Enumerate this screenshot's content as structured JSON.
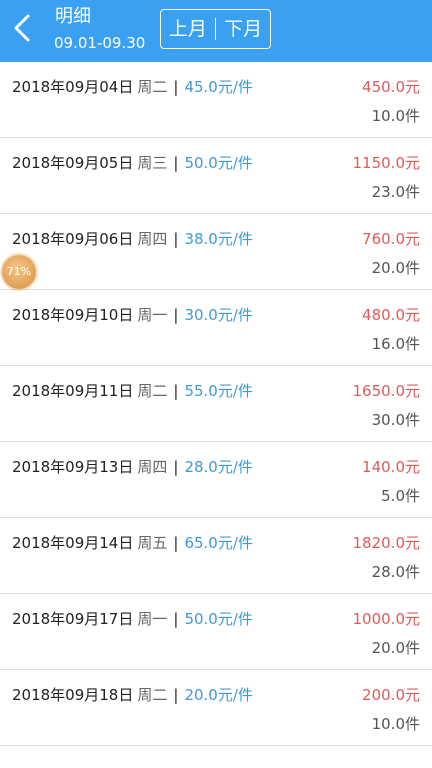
{
  "header": {
    "title": "明细",
    "date_range": "09.01-09.30",
    "prev_month_label": "上月",
    "next_month_label": "下月",
    "background_color": "#3aa0f2"
  },
  "floating_badge": {
    "text": "71%"
  },
  "rows": [
    {
      "date": "2018年09月04日",
      "weekday": "周二",
      "separator": "|",
      "unit_price": "45.0元/件",
      "amount": "450.0元",
      "quantity": "10.0件"
    },
    {
      "date": "2018年09月05日",
      "weekday": "周三",
      "separator": "|",
      "unit_price": "50.0元/件",
      "amount": "1150.0元",
      "quantity": "23.0件"
    },
    {
      "date": "2018年09月06日",
      "weekday": "周四",
      "separator": "|",
      "unit_price": "38.0元/件",
      "amount": "760.0元",
      "quantity": "20.0件"
    },
    {
      "date": "2018年09月10日",
      "weekday": "周一",
      "separator": "|",
      "unit_price": "30.0元/件",
      "amount": "480.0元",
      "quantity": "16.0件"
    },
    {
      "date": "2018年09月11日",
      "weekday": "周二",
      "separator": "|",
      "unit_price": "55.0元/件",
      "amount": "1650.0元",
      "quantity": "30.0件"
    },
    {
      "date": "2018年09月13日",
      "weekday": "周四",
      "separator": "|",
      "unit_price": "28.0元/件",
      "amount": "140.0元",
      "quantity": "5.0件"
    },
    {
      "date": "2018年09月14日",
      "weekday": "周五",
      "separator": "|",
      "unit_price": "65.0元/件",
      "amount": "1820.0元",
      "quantity": "28.0件"
    },
    {
      "date": "2018年09月17日",
      "weekday": "周一",
      "separator": "|",
      "unit_price": "50.0元/件",
      "amount": "1000.0元",
      "quantity": "20.0件"
    },
    {
      "date": "2018年09月18日",
      "weekday": "周二",
      "separator": "|",
      "unit_price": "20.0元/件",
      "amount": "200.0元",
      "quantity": "10.0件"
    }
  ]
}
